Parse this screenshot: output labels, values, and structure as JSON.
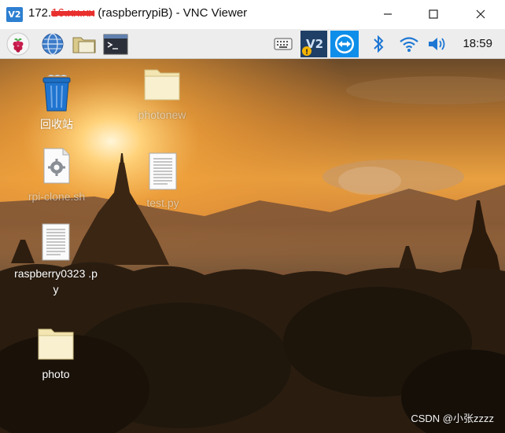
{
  "window": {
    "title_prefix": "172.",
    "title_redacted": "16.xx.xx",
    "title_main": " (raspberrypiB) - VNC Viewer",
    "logo_text": "V2"
  },
  "taskbar": {
    "clock": "18:59",
    "icons": [
      "raspberry-menu-icon",
      "web-browser-icon",
      "file-manager-icon",
      "terminal-icon",
      "keyboard-icon",
      "vnc-server-icon",
      "teamviewer-icon",
      "bluetooth-icon",
      "wifi-icon",
      "volume-icon"
    ]
  },
  "desktop": {
    "items": [
      {
        "label": "回收站",
        "icon": "trash-icon"
      },
      {
        "label": "photonew",
        "icon": "folder-icon"
      },
      {
        "label": "rpi-clone.sh",
        "icon": "script-file-icon"
      },
      {
        "label": "test.py",
        "icon": "text-file-icon"
      },
      {
        "label": "raspberry0323 .p",
        "label2": "y",
        "icon": "text-file-icon"
      },
      {
        "label": "photo",
        "icon": "folder-icon"
      }
    ],
    "watermark": "CSDN @小张zzzz"
  }
}
